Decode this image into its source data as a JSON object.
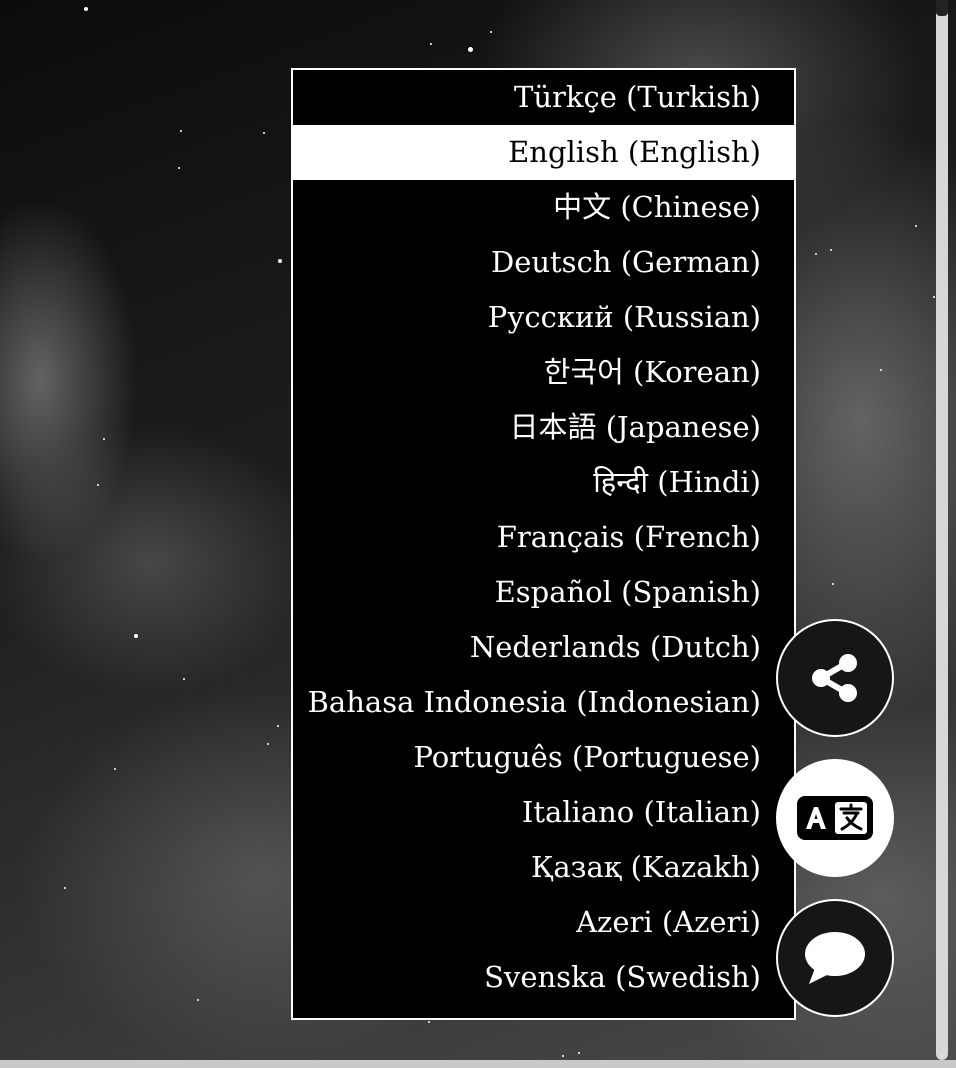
{
  "language_menu": {
    "selected_index": 1,
    "items": [
      {
        "label": "Türkçe (Turkish)"
      },
      {
        "label": "English (English)"
      },
      {
        "label": "中文 (Chinese)"
      },
      {
        "label": "Deutsch (German)"
      },
      {
        "label": "Русский (Russian)"
      },
      {
        "label": "한국어 (Korean)"
      },
      {
        "label": "日本語 (Japanese)"
      },
      {
        "label": "हिन्दी (Hindi)"
      },
      {
        "label": "Français (French)"
      },
      {
        "label": "Español (Spanish)"
      },
      {
        "label": "Nederlands (Dutch)"
      },
      {
        "label": "Bahasa Indonesia (Indonesian)"
      },
      {
        "label": "Português (Portuguese)"
      },
      {
        "label": "Italiano (Italian)"
      },
      {
        "label": "Қазақ (Kazakh)"
      },
      {
        "label": "Azeri (Azeri)"
      },
      {
        "label": "Svenska (Swedish)"
      }
    ]
  },
  "floating_actions": {
    "share": {
      "icon": "share-icon"
    },
    "translate": {
      "icon": "translate-icon",
      "active": true
    },
    "chat": {
      "icon": "chat-bubble-icon"
    }
  },
  "colors": {
    "menu_background": "#000000",
    "menu_text": "#ffffff",
    "selected_background": "#ffffff",
    "selected_text": "#000000"
  }
}
